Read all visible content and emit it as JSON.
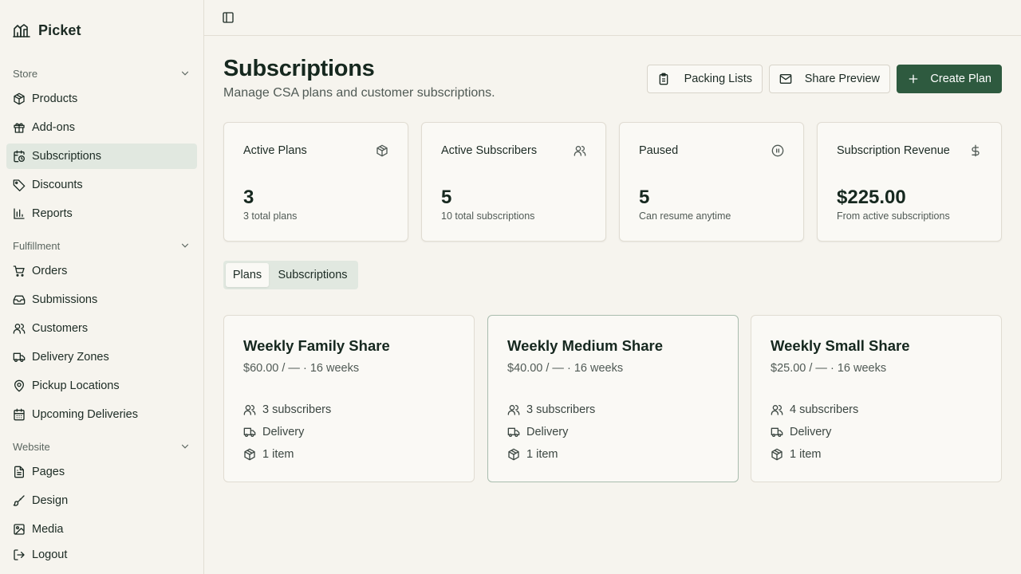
{
  "brand": {
    "name": "Picket"
  },
  "sidebar": {
    "sections": [
      {
        "label": "Store",
        "icon": "chevron-down-icon"
      },
      {
        "label": "Fulfillment",
        "icon": "chevron-down-icon"
      },
      {
        "label": "Website",
        "icon": "chevron-down-icon"
      }
    ],
    "items": [
      {
        "label": "Products",
        "icon": "package-icon"
      },
      {
        "label": "Add-ons",
        "icon": "gift-icon"
      },
      {
        "label": "Subscriptions",
        "icon": "calendar-clock-icon",
        "active": true
      },
      {
        "label": "Discounts",
        "icon": "tag-icon"
      },
      {
        "label": "Reports",
        "icon": "bar-chart-icon"
      },
      {
        "label": "Orders",
        "icon": "cart-icon"
      },
      {
        "label": "Submissions",
        "icon": "inbox-icon"
      },
      {
        "label": "Customers",
        "icon": "users-icon"
      },
      {
        "label": "Delivery Zones",
        "icon": "truck-icon"
      },
      {
        "label": "Pickup Locations",
        "icon": "map-pin-icon"
      },
      {
        "label": "Upcoming Deliveries",
        "icon": "calendar-icon"
      },
      {
        "label": "Pages",
        "icon": "file-text-icon"
      },
      {
        "label": "Design",
        "icon": "brush-icon"
      },
      {
        "label": "Media",
        "icon": "image-icon"
      },
      {
        "label": "Logout",
        "icon": "logout-icon"
      }
    ]
  },
  "header": {
    "title": "Subscriptions",
    "subtitle": "Manage CSA plans and customer subscriptions.",
    "buttons": {
      "packing_lists": "Packing Lists",
      "share_preview": "Share Preview",
      "create_plan": "Create Plan"
    }
  },
  "stats": [
    {
      "label": "Active Plans",
      "value": "3",
      "note": "3 total plans",
      "icon": "package-icon"
    },
    {
      "label": "Active Subscribers",
      "value": "5",
      "note": "10 total subscriptions",
      "icon": "users-icon"
    },
    {
      "label": "Paused",
      "value": "5",
      "note": "Can resume anytime",
      "icon": "pause-circle-icon"
    },
    {
      "label": "Subscription Revenue",
      "value": "$225.00",
      "note": "From active subscriptions",
      "icon": "dollar-icon"
    }
  ],
  "tabs": [
    {
      "label": "Plans",
      "active": true
    },
    {
      "label": "Subscriptions",
      "active": false
    }
  ],
  "plans": [
    {
      "name": "Weekly Family Share",
      "price": "$60.00 / — · 16 weeks",
      "subscribers": "3 subscribers",
      "method": "Delivery",
      "items": "1 item"
    },
    {
      "name": "Weekly Medium Share",
      "price": "$40.00 / — · 16 weeks",
      "subscribers": "3 subscribers",
      "method": "Delivery",
      "items": "1 item"
    },
    {
      "name": "Weekly Small Share",
      "price": "$25.00 / — · 16 weeks",
      "subscribers": "4 subscribers",
      "method": "Delivery",
      "items": "1 item"
    }
  ],
  "colors": {
    "accent": "#2e5a3f",
    "active_bg": "#e1e8e0",
    "page_bg": "#f6f4ee",
    "card_bg": "#faf9f5"
  }
}
